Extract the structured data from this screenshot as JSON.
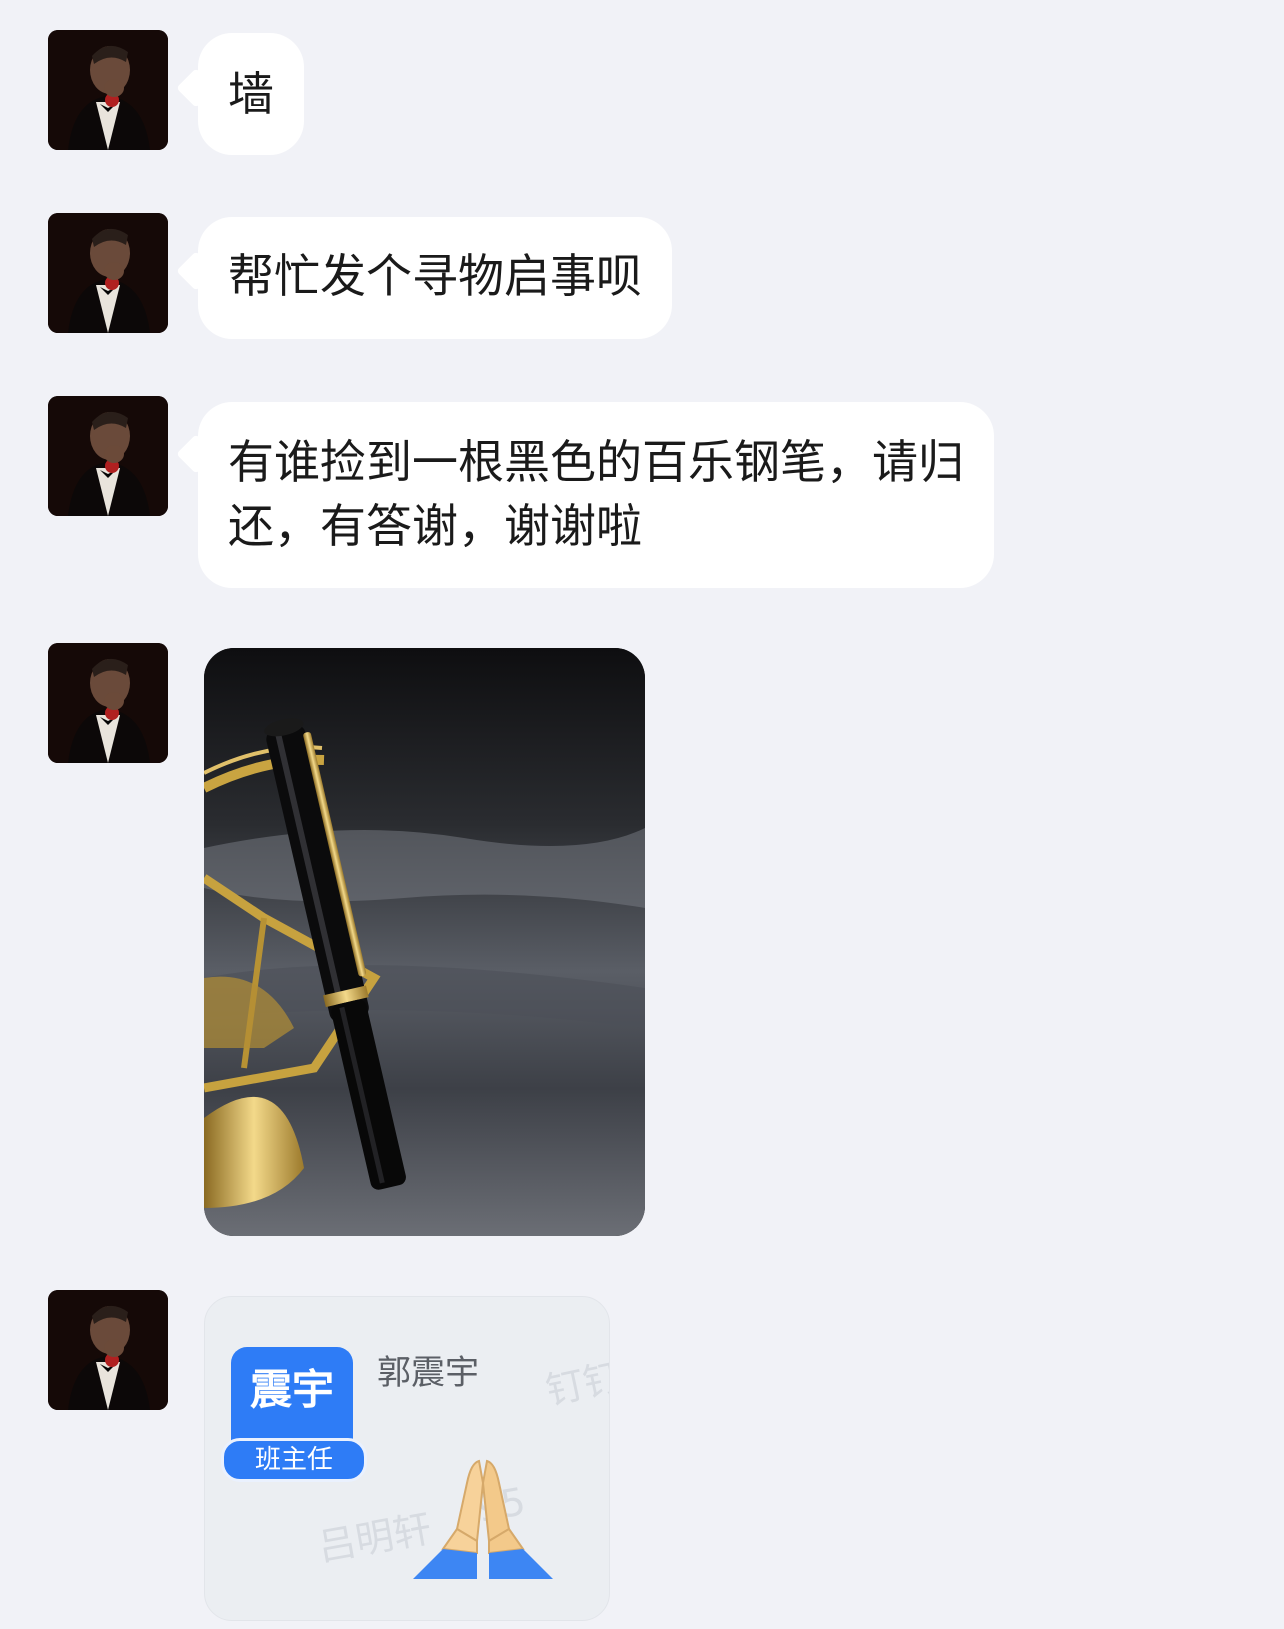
{
  "messages": [
    {
      "type": "text",
      "text": "墙"
    },
    {
      "type": "text",
      "text": "帮忙发个寻物启事呗"
    },
    {
      "type": "text",
      "lines": [
        "有谁捡到一根黑色的百乐钢笔，请归",
        "还，有答谢，谢谢啦"
      ]
    },
    {
      "type": "image",
      "subject": "black fountain pen with gold trim"
    },
    {
      "type": "sticker",
      "badge_name": "震宇",
      "badge_role": "班主任",
      "sender_name": "郭震宇",
      "watermark_left": "吕明轩",
      "watermark_digits": "95",
      "watermark_right": "钉钉",
      "emoji": "folded-hands-icon"
    }
  ],
  "colors": {
    "background": "#f1f2f7",
    "bubble": "#ffffff",
    "badge_blue": "#2e7cf6",
    "pen_gold": "#d8b150"
  }
}
